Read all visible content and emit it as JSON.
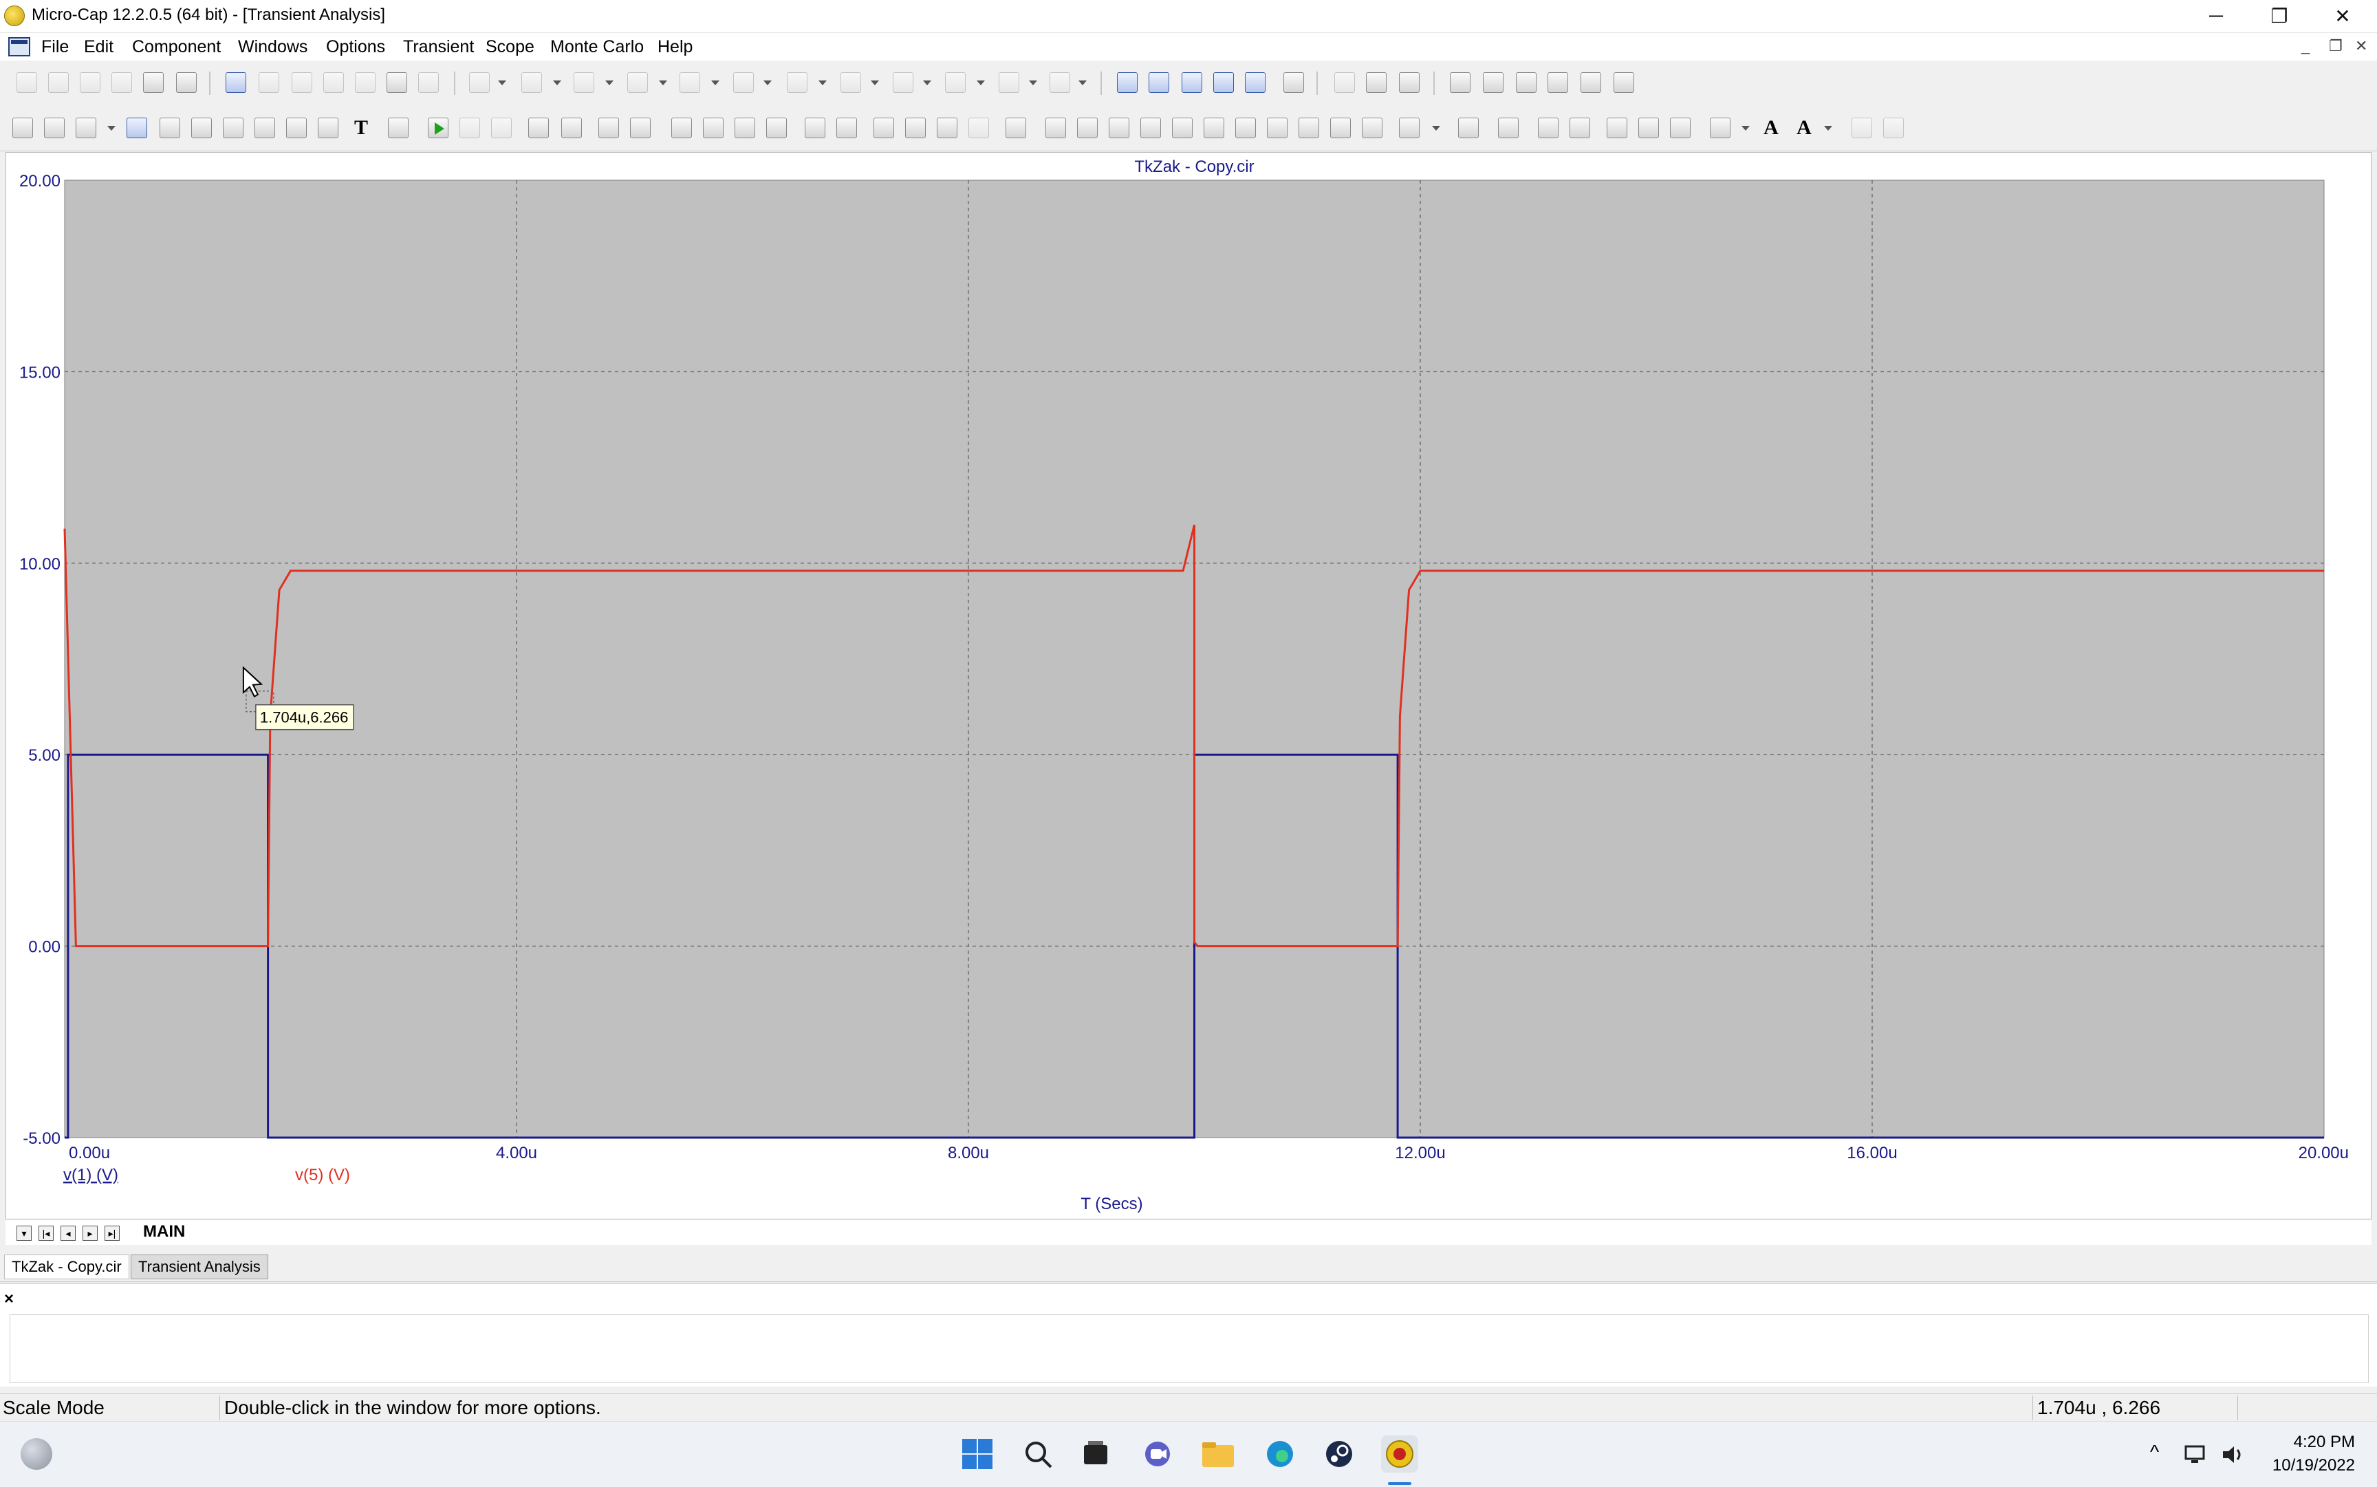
{
  "window": {
    "title": "Micro-Cap 12.2.0.5 (64 bit) - [Transient Analysis]",
    "minimize_glyph": "─",
    "restore_glyph": "❐",
    "close_glyph": "✕"
  },
  "menu": {
    "items": [
      "File",
      "Edit",
      "Component",
      "Windows",
      "Options",
      "Transient",
      "Scope",
      "Monte Carlo",
      "Help"
    ],
    "mdi_minimize": "_",
    "mdi_restore": "❐",
    "mdi_close": "✕"
  },
  "toolbar_icons": {
    "text_tool": "T",
    "font_tool": "A",
    "style_tool": "A"
  },
  "chart_data": {
    "type": "line",
    "title": "TkZak - Copy.cir",
    "xlabel": "T (Secs)",
    "x_unit": "seconds",
    "xlim": [
      0,
      2e-05
    ],
    "ylim": [
      -5,
      20
    ],
    "grid": true,
    "x_ticks": [
      0,
      4e-06,
      8e-06,
      1.2e-05,
      1.6e-05,
      2e-05
    ],
    "x_tick_labels": [
      "0.00u",
      "4.00u",
      "8.00u",
      "12.00u",
      "16.00u",
      "20.00u"
    ],
    "y_ticks": [
      -5,
      0,
      5,
      10,
      15,
      20
    ],
    "y_tick_labels": [
      "-5.00",
      "0.00",
      "5.00",
      "10.00",
      "15.00",
      "20.00"
    ],
    "background": "#c0c0c0",
    "series": [
      {
        "name": "v(1) (V)",
        "color": "#1a1a8c",
        "x": [
          0,
          3e-08,
          3e-08,
          1.8e-06,
          1.8e-06,
          1e-05,
          1e-05,
          1.18e-05,
          1.18e-05,
          2e-05
        ],
        "y": [
          -5,
          -5,
          5,
          5,
          -5,
          -5,
          5,
          5,
          -5,
          -5
        ]
      },
      {
        "name": "v(5) (V)",
        "color": "#e03020",
        "x": [
          0,
          1e-07,
          1e-07,
          1.8e-06,
          1.82e-06,
          1.9e-06,
          2e-06,
          9.9e-06,
          1e-05,
          1e-05,
          1.003e-05,
          1.18e-05,
          1.182e-05,
          1.19e-05,
          1.2e-05,
          2e-05
        ],
        "y": [
          10.9,
          0,
          0,
          0,
          6,
          9.3,
          9.8,
          9.8,
          11.0,
          0.1,
          0,
          0,
          6,
          9.3,
          9.8,
          9.8
        ]
      }
    ],
    "cursor_tooltip": "1.704u,6.266",
    "cursor_x": 1.704e-06,
    "cursor_y": 6.266
  },
  "sheet_tabs": {
    "active": "MAIN"
  },
  "doc_tabs": [
    "TkZak - Copy.cir",
    "Transient Analysis"
  ],
  "output_panel": {
    "close_glyph": "×"
  },
  "status": {
    "mode": "Scale Mode",
    "hint": "Double-click in the window for more options.",
    "coords": "1.704u , 6.266"
  },
  "taskbar": {
    "time": "4:20 PM",
    "date": "10/19/2022",
    "chevron": "^"
  }
}
